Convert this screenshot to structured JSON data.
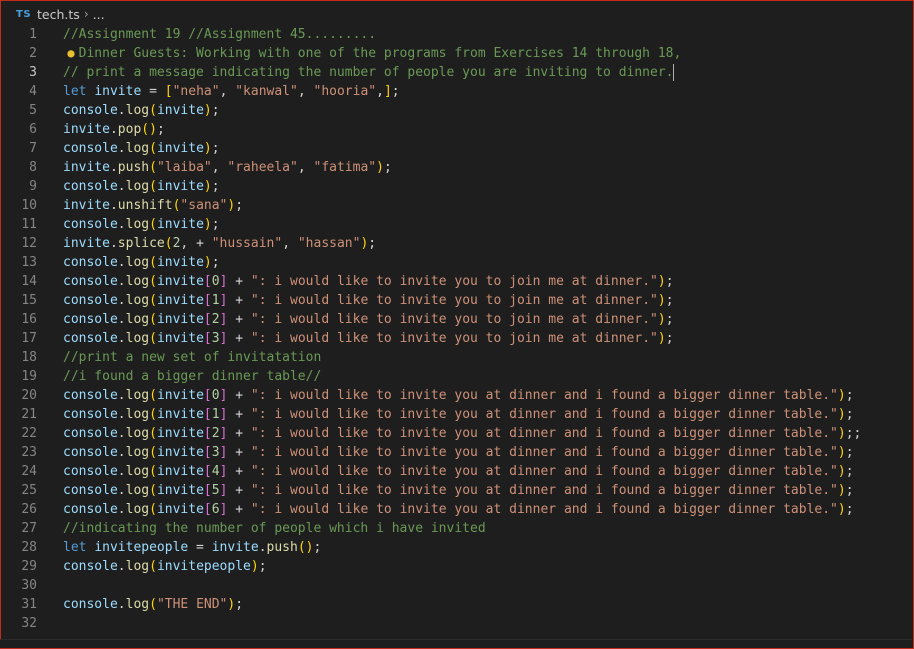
{
  "breadcrumb": {
    "file_icon": "TS",
    "file_name": "tech.ts",
    "separator": "›",
    "more": "..."
  },
  "editor": {
    "active_line": 3,
    "lines": [
      {
        "n": "1",
        "tokens": [
          [
            "c",
            "//Assignment 19 //Assignment 45........."
          ]
        ]
      },
      {
        "n": "2",
        "tokens": [
          [
            "c",
            "//Dinner Guests: Working with one of the programs from Exercises 14 through 18,"
          ]
        ]
      },
      {
        "n": "3",
        "tokens": [
          [
            "c",
            "// print a message indicating the number of people you are inviting to dinner."
          ],
          [
            "cursor",
            ""
          ]
        ]
      },
      {
        "n": "4",
        "tokens": [
          [
            "k",
            "let"
          ],
          [
            "p",
            " "
          ],
          [
            "v",
            "invite"
          ],
          [
            "p",
            " = "
          ],
          [
            "b1",
            "["
          ],
          [
            "s",
            "\"neha\""
          ],
          [
            "p",
            ", "
          ],
          [
            "s",
            "\"kanwal\""
          ],
          [
            "p",
            ", "
          ],
          [
            "s",
            "\"hooria\""
          ],
          [
            "p",
            ","
          ],
          [
            "b1",
            "]"
          ],
          [
            "p",
            ";"
          ]
        ]
      },
      {
        "n": "5",
        "tokens": [
          [
            "v",
            "console"
          ],
          [
            "p",
            "."
          ],
          [
            "f",
            "log"
          ],
          [
            "b1",
            "("
          ],
          [
            "v",
            "invite"
          ],
          [
            "b1",
            ")"
          ],
          [
            "p",
            ";"
          ]
        ]
      },
      {
        "n": "6",
        "tokens": [
          [
            "v",
            "invite"
          ],
          [
            "p",
            "."
          ],
          [
            "f",
            "pop"
          ],
          [
            "b1",
            "()"
          ],
          [
            "p",
            ";"
          ]
        ]
      },
      {
        "n": "7",
        "tokens": [
          [
            "v",
            "console"
          ],
          [
            "p",
            "."
          ],
          [
            "f",
            "log"
          ],
          [
            "b1",
            "("
          ],
          [
            "v",
            "invite"
          ],
          [
            "b1",
            ")"
          ],
          [
            "p",
            ";"
          ]
        ]
      },
      {
        "n": "8",
        "tokens": [
          [
            "v",
            "invite"
          ],
          [
            "p",
            "."
          ],
          [
            "f",
            "push"
          ],
          [
            "b1",
            "("
          ],
          [
            "s",
            "\"laiba\""
          ],
          [
            "p",
            ", "
          ],
          [
            "s",
            "\"raheela\""
          ],
          [
            "p",
            ", "
          ],
          [
            "s",
            "\"fatima\""
          ],
          [
            "b1",
            ")"
          ],
          [
            "p",
            ";"
          ]
        ]
      },
      {
        "n": "9",
        "tokens": [
          [
            "v",
            "console"
          ],
          [
            "p",
            "."
          ],
          [
            "f",
            "log"
          ],
          [
            "b1",
            "("
          ],
          [
            "v",
            "invite"
          ],
          [
            "b1",
            ")"
          ],
          [
            "p",
            ";"
          ]
        ]
      },
      {
        "n": "10",
        "tokens": [
          [
            "v",
            "invite"
          ],
          [
            "p",
            "."
          ],
          [
            "f",
            "unshift"
          ],
          [
            "b1",
            "("
          ],
          [
            "s",
            "\"sana\""
          ],
          [
            "b1",
            ")"
          ],
          [
            "p",
            ";"
          ]
        ]
      },
      {
        "n": "11",
        "tokens": [
          [
            "v",
            "console"
          ],
          [
            "p",
            "."
          ],
          [
            "f",
            "log"
          ],
          [
            "b1",
            "("
          ],
          [
            "v",
            "invite"
          ],
          [
            "b1",
            ")"
          ],
          [
            "p",
            ";"
          ]
        ]
      },
      {
        "n": "12",
        "tokens": [
          [
            "v",
            "invite"
          ],
          [
            "p",
            "."
          ],
          [
            "f",
            "splice"
          ],
          [
            "b1",
            "("
          ],
          [
            "n",
            "2"
          ],
          [
            "p",
            ", + "
          ],
          [
            "s",
            "\"hussain\""
          ],
          [
            "p",
            ", "
          ],
          [
            "s",
            "\"hassan\""
          ],
          [
            "b1",
            ")"
          ],
          [
            "p",
            ";"
          ]
        ]
      },
      {
        "n": "13",
        "tokens": [
          [
            "v",
            "console"
          ],
          [
            "p",
            "."
          ],
          [
            "f",
            "log"
          ],
          [
            "b1",
            "("
          ],
          [
            "v",
            "invite"
          ],
          [
            "b1",
            ")"
          ],
          [
            "p",
            ";"
          ]
        ]
      },
      {
        "n": "14",
        "tokens": [
          [
            "v",
            "console"
          ],
          [
            "p",
            "."
          ],
          [
            "f",
            "log"
          ],
          [
            "b1",
            "("
          ],
          [
            "v",
            "invite"
          ],
          [
            "b2",
            "["
          ],
          [
            "n",
            "0"
          ],
          [
            "b2",
            "]"
          ],
          [
            "p",
            " + "
          ],
          [
            "s",
            "\": i would like to invite you to join me at dinner.\""
          ],
          [
            "b1",
            ")"
          ],
          [
            "p",
            ";"
          ]
        ]
      },
      {
        "n": "15",
        "tokens": [
          [
            "v",
            "console"
          ],
          [
            "p",
            "."
          ],
          [
            "f",
            "log"
          ],
          [
            "b1",
            "("
          ],
          [
            "v",
            "invite"
          ],
          [
            "b2",
            "["
          ],
          [
            "n",
            "1"
          ],
          [
            "b2",
            "]"
          ],
          [
            "p",
            " + "
          ],
          [
            "s",
            "\": i would like to invite you to join me at dinner.\""
          ],
          [
            "b1",
            ")"
          ],
          [
            "p",
            ";"
          ]
        ]
      },
      {
        "n": "16",
        "tokens": [
          [
            "v",
            "console"
          ],
          [
            "p",
            "."
          ],
          [
            "f",
            "log"
          ],
          [
            "b1",
            "("
          ],
          [
            "v",
            "invite"
          ],
          [
            "b2",
            "["
          ],
          [
            "n",
            "2"
          ],
          [
            "b2",
            "]"
          ],
          [
            "p",
            " + "
          ],
          [
            "s",
            "\": i would like to invite you to join me at dinner.\""
          ],
          [
            "b1",
            ")"
          ],
          [
            "p",
            ";"
          ]
        ]
      },
      {
        "n": "17",
        "tokens": [
          [
            "v",
            "console"
          ],
          [
            "p",
            "."
          ],
          [
            "f",
            "log"
          ],
          [
            "b1",
            "("
          ],
          [
            "v",
            "invite"
          ],
          [
            "b2",
            "["
          ],
          [
            "n",
            "3"
          ],
          [
            "b2",
            "]"
          ],
          [
            "p",
            " + "
          ],
          [
            "s",
            "\": i would like to invite you to join me at dinner.\""
          ],
          [
            "b1",
            ")"
          ],
          [
            "p",
            ";"
          ]
        ]
      },
      {
        "n": "18",
        "tokens": [
          [
            "c",
            "//print a new set of invitatation"
          ]
        ]
      },
      {
        "n": "19",
        "tokens": [
          [
            "c",
            "//i found a bigger dinner table//"
          ]
        ]
      },
      {
        "n": "20",
        "tokens": [
          [
            "v",
            "console"
          ],
          [
            "p",
            "."
          ],
          [
            "f",
            "log"
          ],
          [
            "b1",
            "("
          ],
          [
            "v",
            "invite"
          ],
          [
            "b2",
            "["
          ],
          [
            "n",
            "0"
          ],
          [
            "b2",
            "]"
          ],
          [
            "p",
            " + "
          ],
          [
            "s",
            "\": i would like to invite you at dinner and i found a bigger dinner table.\""
          ],
          [
            "b1",
            ")"
          ],
          [
            "p",
            ";"
          ]
        ]
      },
      {
        "n": "21",
        "tokens": [
          [
            "v",
            "console"
          ],
          [
            "p",
            "."
          ],
          [
            "f",
            "log"
          ],
          [
            "b1",
            "("
          ],
          [
            "v",
            "invite"
          ],
          [
            "b2",
            "["
          ],
          [
            "n",
            "1"
          ],
          [
            "b2",
            "]"
          ],
          [
            "p",
            " + "
          ],
          [
            "s",
            "\": i would like to invite you at dinner and i found a bigger dinner table.\""
          ],
          [
            "b1",
            ")"
          ],
          [
            "p",
            ";"
          ]
        ]
      },
      {
        "n": "22",
        "tokens": [
          [
            "v",
            "console"
          ],
          [
            "p",
            "."
          ],
          [
            "f",
            "log"
          ],
          [
            "b1",
            "("
          ],
          [
            "v",
            "invite"
          ],
          [
            "b2",
            "["
          ],
          [
            "n",
            "2"
          ],
          [
            "b2",
            "]"
          ],
          [
            "p",
            " + "
          ],
          [
            "s",
            "\": i would like to invite you at dinner and i found a bigger dinner table.\""
          ],
          [
            "b1",
            ")"
          ],
          [
            "p",
            ";;"
          ]
        ]
      },
      {
        "n": "23",
        "tokens": [
          [
            "v",
            "console"
          ],
          [
            "p",
            "."
          ],
          [
            "f",
            "log"
          ],
          [
            "b1",
            "("
          ],
          [
            "v",
            "invite"
          ],
          [
            "b2",
            "["
          ],
          [
            "n",
            "3"
          ],
          [
            "b2",
            "]"
          ],
          [
            "p",
            " + "
          ],
          [
            "s",
            "\": i would like to invite you at dinner and i found a bigger dinner table.\""
          ],
          [
            "b1",
            ")"
          ],
          [
            "p",
            ";"
          ]
        ]
      },
      {
        "n": "24",
        "tokens": [
          [
            "v",
            "console"
          ],
          [
            "p",
            "."
          ],
          [
            "f",
            "log"
          ],
          [
            "b1",
            "("
          ],
          [
            "v",
            "invite"
          ],
          [
            "b2",
            "["
          ],
          [
            "n",
            "4"
          ],
          [
            "b2",
            "]"
          ],
          [
            "p",
            " + "
          ],
          [
            "s",
            "\": i would like to invite you at dinner and i found a bigger dinner table.\""
          ],
          [
            "b1",
            ")"
          ],
          [
            "p",
            ";"
          ]
        ]
      },
      {
        "n": "25",
        "tokens": [
          [
            "v",
            "console"
          ],
          [
            "p",
            "."
          ],
          [
            "f",
            "log"
          ],
          [
            "b1",
            "("
          ],
          [
            "v",
            "invite"
          ],
          [
            "b2",
            "["
          ],
          [
            "n",
            "5"
          ],
          [
            "b2",
            "]"
          ],
          [
            "p",
            " + "
          ],
          [
            "s",
            "\": i would like to invite you at dinner and i found a bigger dinner table.\""
          ],
          [
            "b1",
            ")"
          ],
          [
            "p",
            ";"
          ]
        ]
      },
      {
        "n": "26",
        "tokens": [
          [
            "v",
            "console"
          ],
          [
            "p",
            "."
          ],
          [
            "f",
            "log"
          ],
          [
            "b1",
            "("
          ],
          [
            "v",
            "invite"
          ],
          [
            "b2",
            "["
          ],
          [
            "n",
            "6"
          ],
          [
            "b2",
            "]"
          ],
          [
            "p",
            " + "
          ],
          [
            "s",
            "\": i would like to invite you at dinner and i found a bigger dinner table.\""
          ],
          [
            "b1",
            ")"
          ],
          [
            "p",
            ";"
          ]
        ]
      },
      {
        "n": "27",
        "tokens": [
          [
            "c",
            "//indicating the number of people which i have invited"
          ]
        ]
      },
      {
        "n": "28",
        "tokens": [
          [
            "k",
            "let"
          ],
          [
            "p",
            " "
          ],
          [
            "v",
            "invitepeople"
          ],
          [
            "p",
            " = "
          ],
          [
            "v",
            "invite"
          ],
          [
            "p",
            "."
          ],
          [
            "f",
            "push"
          ],
          [
            "b1",
            "()"
          ],
          [
            "p",
            ";"
          ]
        ]
      },
      {
        "n": "29",
        "tokens": [
          [
            "v",
            "console"
          ],
          [
            "p",
            "."
          ],
          [
            "f",
            "log"
          ],
          [
            "b1",
            "("
          ],
          [
            "v",
            "invitepeople"
          ],
          [
            "b1",
            ")"
          ],
          [
            "p",
            ";"
          ]
        ]
      },
      {
        "n": "30",
        "tokens": []
      },
      {
        "n": "31",
        "tokens": [
          [
            "v",
            "console"
          ],
          [
            "p",
            "."
          ],
          [
            "f",
            "log"
          ],
          [
            "b1",
            "("
          ],
          [
            "s",
            "\"THE END\""
          ],
          [
            "b1",
            ")"
          ],
          [
            "p",
            ";"
          ]
        ]
      },
      {
        "n": "32",
        "tokens": []
      }
    ]
  },
  "icons": {
    "lightbulb": "lightbulb-icon",
    "file_type": "typescript-file-icon"
  },
  "colors": {
    "background": "#1e1e1e",
    "comment": "#6a9955",
    "keyword": "#569cd6",
    "variable": "#9cdcfe",
    "string": "#ce9178",
    "function": "#dcdcaa",
    "number": "#b5cea8",
    "bracket1": "#ffd700",
    "bracket2": "#da70d6",
    "window_border": "#c42b1c"
  }
}
